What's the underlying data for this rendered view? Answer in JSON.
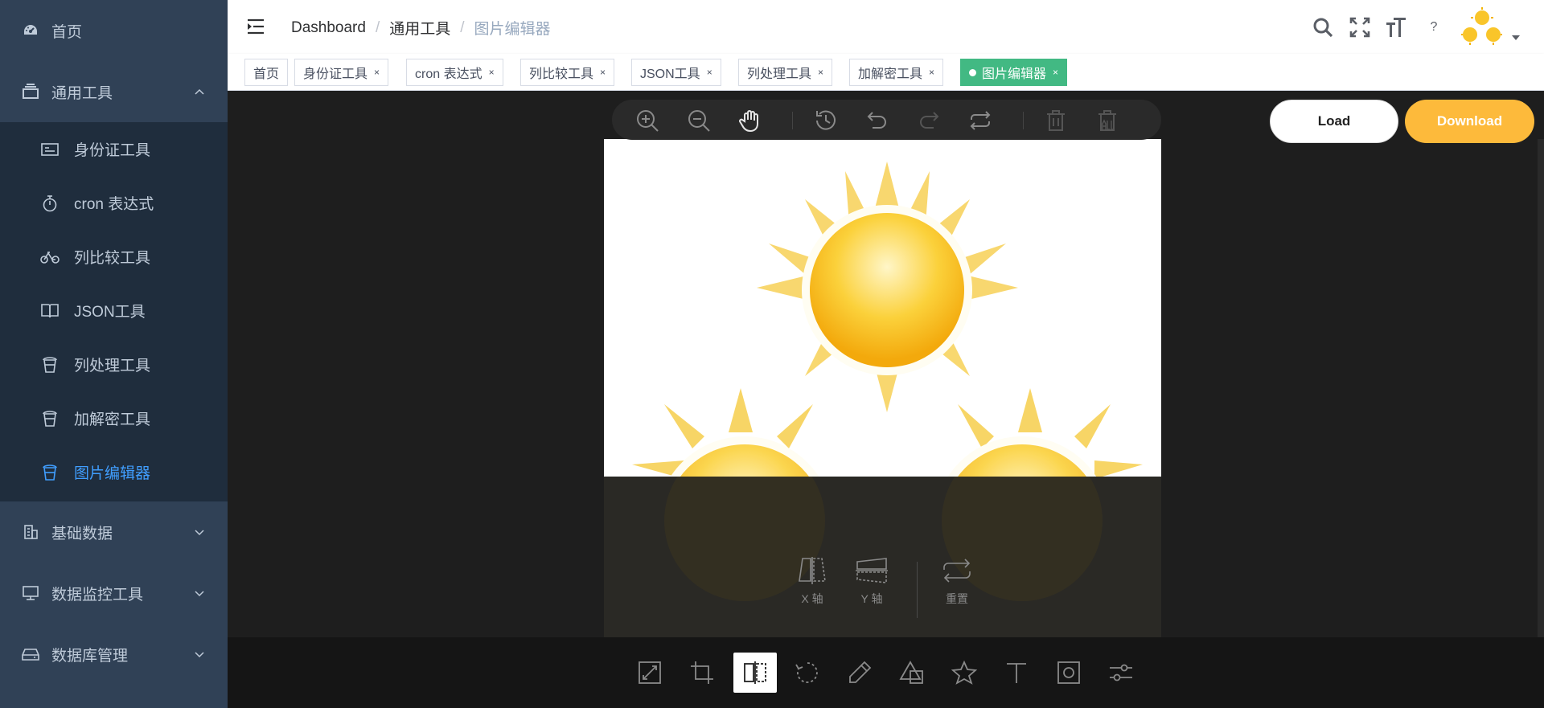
{
  "sidebar": {
    "home": {
      "label": "首页",
      "icon": "dashboard-icon"
    },
    "general_tools": {
      "label": "通用工具",
      "icon": "layers-icon",
      "expanded": true
    },
    "sub_items": [
      {
        "label": "身份证工具",
        "icon": "id-card-icon"
      },
      {
        "label": "cron 表达式",
        "icon": "stopwatch-icon"
      },
      {
        "label": "列比较工具",
        "icon": "bicycle-icon"
      },
      {
        "label": "JSON工具",
        "icon": "book-icon"
      },
      {
        "label": "列处理工具",
        "icon": "cup-icon"
      },
      {
        "label": "加解密工具",
        "icon": "cup-icon"
      },
      {
        "label": "图片编辑器",
        "icon": "cup-icon",
        "active": true
      }
    ],
    "groups": [
      {
        "label": "基础数据",
        "icon": "building-icon"
      },
      {
        "label": "数据监控工具",
        "icon": "monitor-icon"
      },
      {
        "label": "数据库管理",
        "icon": "disk-icon"
      }
    ],
    "colors": {
      "bg": "#304156",
      "submenu_bg": "#1f2d3d",
      "text": "#bfcbd9",
      "active": "#409eff"
    }
  },
  "header": {
    "breadcrumb": [
      "Dashboard",
      "通用工具",
      "图片编辑器"
    ],
    "separator": "/",
    "help": "?"
  },
  "tags": [
    {
      "label": "首页",
      "closable": false
    },
    {
      "label": "身份证工具",
      "closable": true
    },
    {
      "label": "cron 表达式",
      "closable": true
    },
    {
      "label": "列比较工具",
      "closable": true
    },
    {
      "label": "JSON工具",
      "closable": true
    },
    {
      "label": "列处理工具",
      "closable": true
    },
    {
      "label": "加解密工具",
      "closable": true
    },
    {
      "label": "图片编辑器",
      "closable": true,
      "active": true
    }
  ],
  "tag_close": "×",
  "editor": {
    "load_label": "Load",
    "download_label": "Download",
    "top_toolbar": [
      "zoom-in-icon",
      "zoom-out-icon",
      "hand-icon",
      "history-icon",
      "undo-icon",
      "redo-icon",
      "reset-icon",
      "delete-icon",
      "delete-all-icon"
    ],
    "flip_options": [
      {
        "label": "X 轴",
        "icon": "flip-x-icon"
      },
      {
        "label": "Y 轴",
        "icon": "flip-y-icon"
      },
      {
        "label": "重置",
        "icon": "reset-icon"
      }
    ],
    "bottom_menu": [
      "resize-icon",
      "crop-icon",
      "flip-icon",
      "rotate-icon",
      "draw-icon",
      "shape-icon",
      "star-icon",
      "text-icon",
      "mask-icon",
      "filter-icon"
    ],
    "active_menu": "flip-icon",
    "colors": {
      "bg": "#1e1e1e",
      "download": "#fdba3b",
      "accent_tag": "#42b983"
    }
  }
}
